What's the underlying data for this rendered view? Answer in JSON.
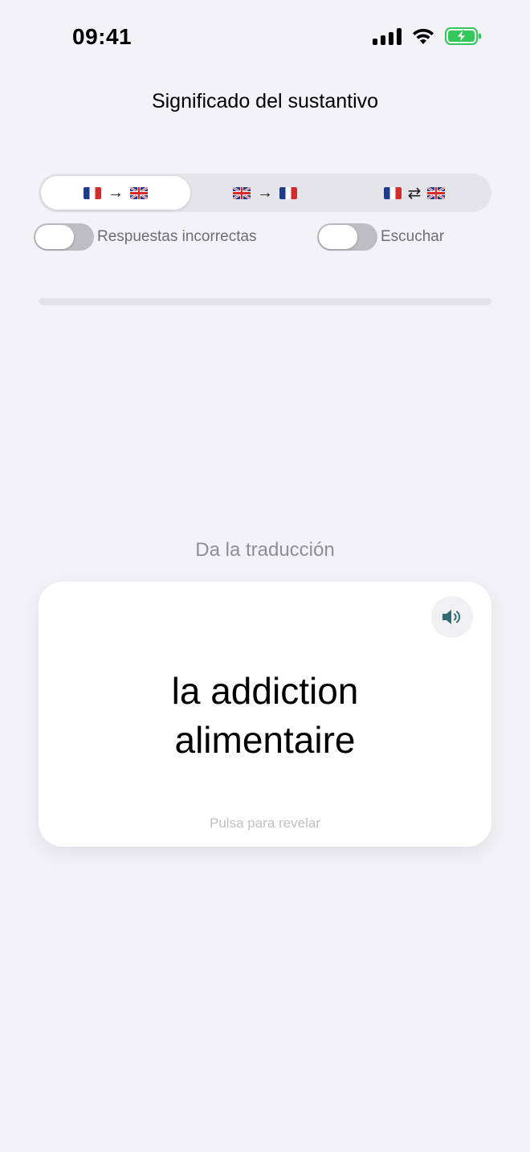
{
  "status_bar": {
    "time": "09:41",
    "icons": [
      "cellular-signal-icon",
      "wifi-icon",
      "battery-charging-icon"
    ],
    "battery_color": "#34c759"
  },
  "header": {
    "title": "Significado del sustantivo"
  },
  "direction_selector": {
    "segments": [
      {
        "from": "flag-france",
        "arrow": "→",
        "to": "flag-uk",
        "selected": true
      },
      {
        "from": "flag-uk",
        "arrow": "→",
        "to": "flag-france",
        "selected": false
      },
      {
        "from": "flag-france",
        "arrow": "⇄",
        "to": "flag-uk",
        "selected": false
      }
    ]
  },
  "toggles": {
    "wrong_answers": {
      "label": "Respuestas incorrectas",
      "on": false
    },
    "listen": {
      "label": "Escuchar",
      "on": false
    }
  },
  "progress": {
    "fraction": 0
  },
  "quiz": {
    "prompt": "Da la traducción",
    "card": {
      "word_line1": "la addiction",
      "word_line2": "alimentaire",
      "hint": "Pulsa para revelar",
      "speaker_icon": "speaker-icon",
      "speaker_color": "#2e6b73"
    }
  }
}
